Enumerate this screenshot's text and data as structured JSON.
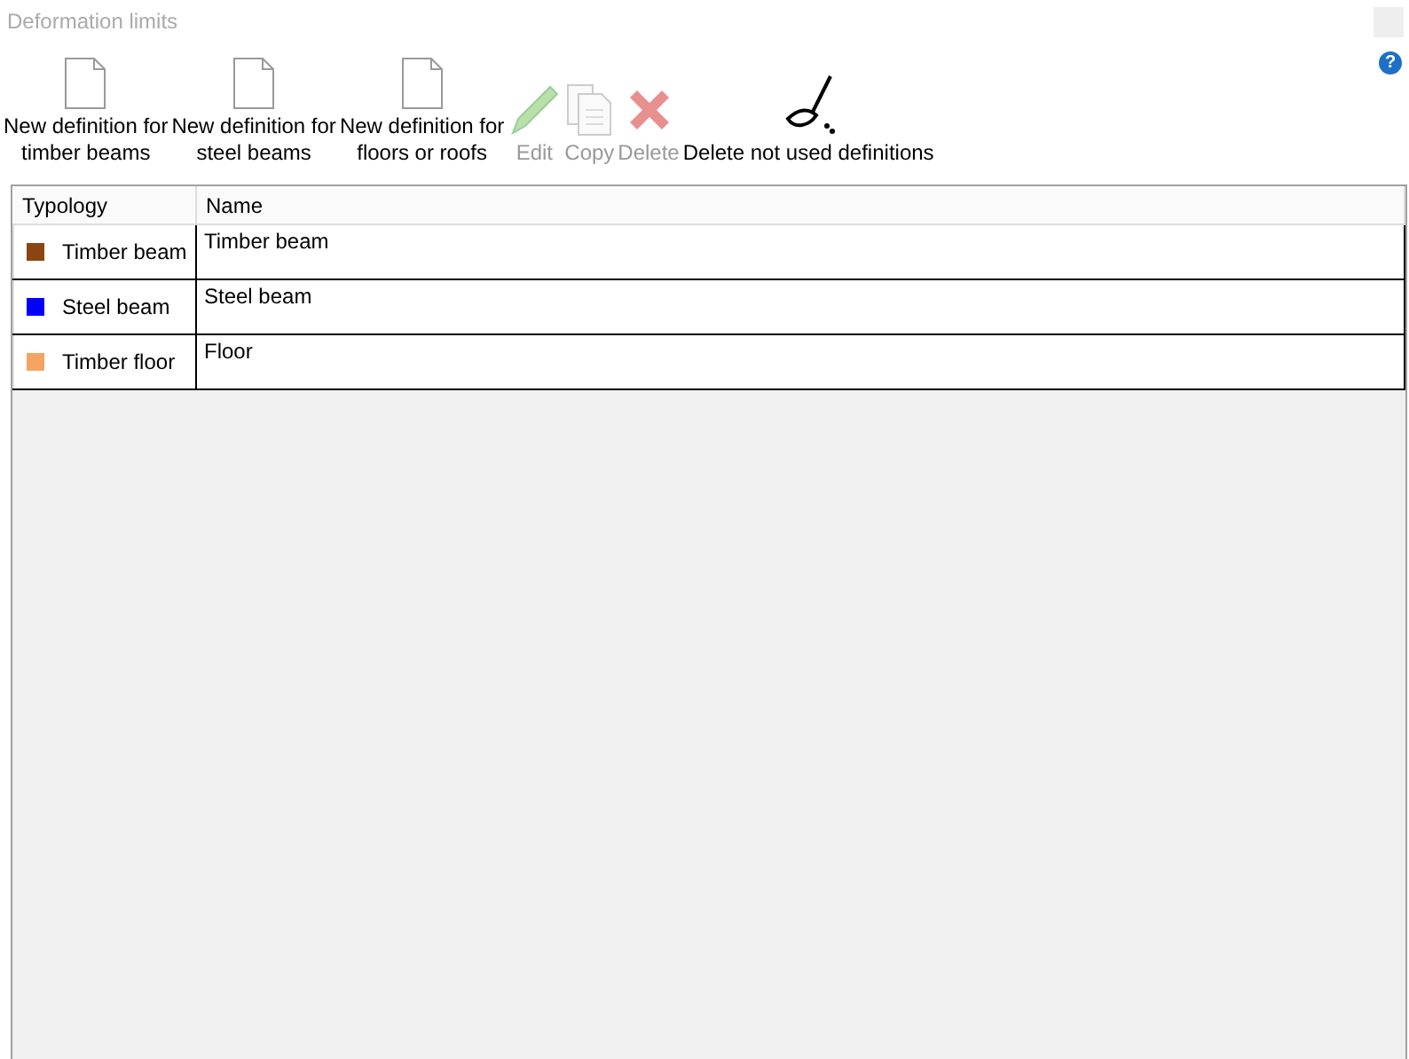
{
  "window": {
    "title": "Deformation limits",
    "help": "?"
  },
  "toolbar": [
    {
      "kind": "new",
      "label": "New definition for\ntimber beams",
      "disabled": false
    },
    {
      "kind": "new",
      "label": "New definition for\nsteel beams",
      "disabled": false
    },
    {
      "kind": "new",
      "label": "New definition for\nfloors or roofs",
      "disabled": false
    },
    {
      "kind": "edit",
      "label": "Edit",
      "disabled": true
    },
    {
      "kind": "copy",
      "label": "Copy",
      "disabled": true
    },
    {
      "kind": "delete",
      "label": "Delete",
      "disabled": true
    },
    {
      "kind": "clean",
      "label": "Delete not used definitions",
      "disabled": false
    }
  ],
  "table": {
    "columns": [
      "Typology",
      "Name"
    ],
    "rows": [
      {
        "typology": "Timber beam",
        "color": "#8b4513",
        "name": "Timber beam"
      },
      {
        "typology": "Steel beam",
        "color": "#0000ff",
        "name": "Steel beam"
      },
      {
        "typology": "Timber floor",
        "color": "#f4a460",
        "name": "Floor"
      }
    ]
  }
}
